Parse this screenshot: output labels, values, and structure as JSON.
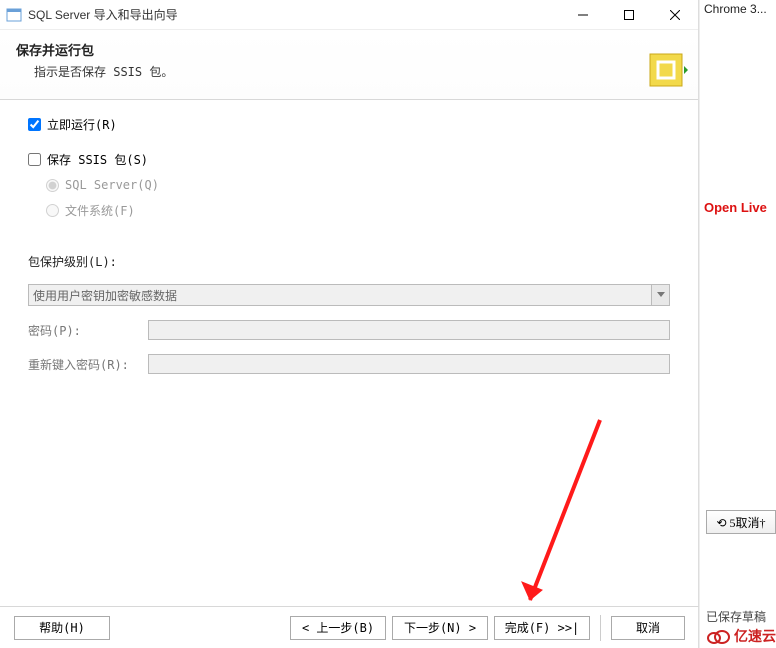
{
  "window": {
    "title": "SQL Server 导入和导出向导"
  },
  "header": {
    "title": "保存并运行包",
    "subtitle": "指示是否保存 SSIS 包。"
  },
  "options": {
    "run_now_label": "立即运行(R)",
    "save_ssis_label": "保存 SSIS 包(S)",
    "radio_sqlserver": "SQL Server(Q)",
    "radio_filesystem": "文件系统(F)"
  },
  "protection": {
    "label": "包保护级别(L):",
    "selected": "使用用户密钥加密敏感数据"
  },
  "password": {
    "pw_label": "密码(P):",
    "repw_label": "重新键入密码(R):"
  },
  "footer": {
    "help": "帮助(H)",
    "back": "<  上一步(B)",
    "next": "下一步(N)  >",
    "finish": "完成(F)  >>|",
    "cancel": "取消"
  },
  "rightside": {
    "chrome_tab": "Chrome 3...",
    "open_live": "Open Live",
    "revoke": "⟲ 5取消†",
    "saved": "已保存草稿",
    "logo_text": "亿速云"
  }
}
